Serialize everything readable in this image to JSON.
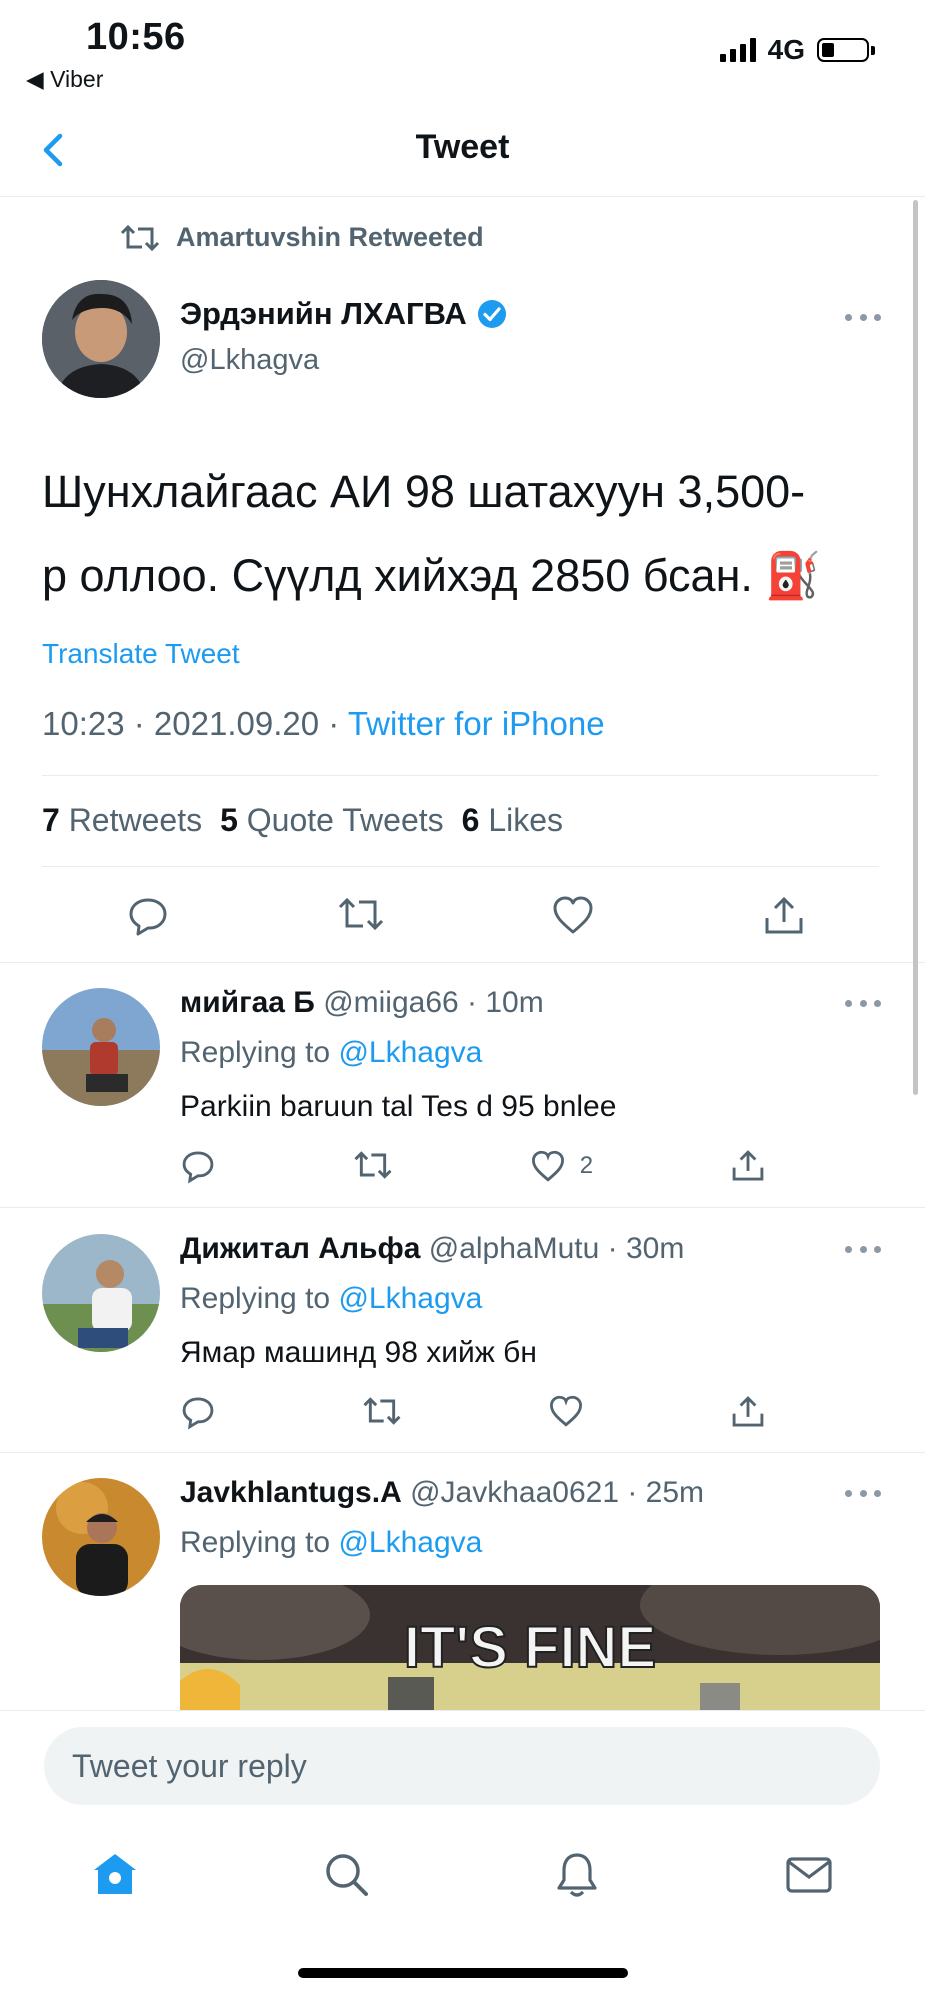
{
  "status_bar": {
    "time": "10:56",
    "back_app": "◀ Viber",
    "network": "4G"
  },
  "nav": {
    "title": "Tweet"
  },
  "main_tweet": {
    "retweeted_by": "Amartuvshin Retweeted",
    "author_name": "Эрдэнийн ЛХАГВА",
    "author_handle": "@Lkhagva",
    "text_line1": "Шунхлайгаас АИ 98 шатахуун 3,500-",
    "text_line2": "р оллоо. Сүүлд хийхэд 2850 бсан. ⛽",
    "translate": "Translate Tweet",
    "time": "10:23 · 2021.09.20 · ",
    "source": "Twitter for iPhone",
    "retweets_count": "7",
    "retweets_label": "Retweets",
    "quotes_count": "5",
    "quotes_label": "Quote Tweets",
    "likes_count": "6",
    "likes_label": "Likes"
  },
  "replies": [
    {
      "name": "мийгаа Б",
      "handle_time": "@miiga66 · 10m",
      "replying_prefix": "Replying to ",
      "replying_to": "@Lkhagva",
      "text": "Parkiin baruun tal Tes d 95 bnlee",
      "like_count": "2"
    },
    {
      "name": "Дижитал Альфа",
      "handle_time": "@alphaMutu · 30m",
      "replying_prefix": "Replying to ",
      "replying_to": "@Lkhagva",
      "text": "Ямар машинд 98 хийж бн"
    },
    {
      "name": "Javkhlantugs.A",
      "handle_time": "@Javkhaa0621 · 25m",
      "replying_prefix": "Replying to ",
      "replying_to": "@Lkhagva",
      "gif_text": "IT'S FINE"
    }
  ],
  "compose": {
    "placeholder": "Tweet your reply"
  },
  "colors": {
    "accent": "#1d9bf0",
    "secondary_text": "#536471",
    "divider": "#e6ecf0"
  }
}
